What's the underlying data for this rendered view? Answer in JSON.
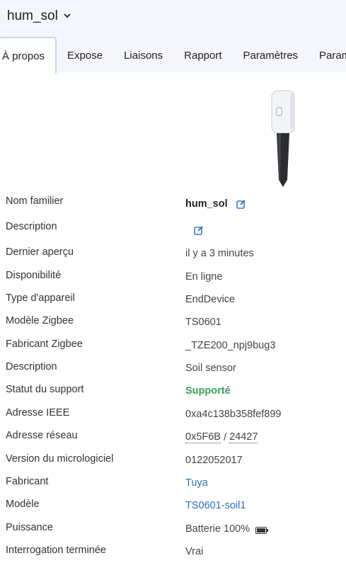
{
  "header": {
    "device_name": "hum_sol"
  },
  "tabs": [
    {
      "label": "À propos",
      "active": true
    },
    {
      "label": "Expose"
    },
    {
      "label": "Liaisons"
    },
    {
      "label": "Rapport"
    },
    {
      "label": "Paramètres"
    },
    {
      "label": "Param"
    }
  ],
  "details": {
    "friendly_name": {
      "label": "Nom familier",
      "value": "hum_sol"
    },
    "description_edit": {
      "label": "Description"
    },
    "last_seen": {
      "label": "Dernier aperçu",
      "value": "il y a 3 minutes"
    },
    "availability": {
      "label": "Disponibilité",
      "value": "En ligne"
    },
    "device_type": {
      "label": "Type d'appareil",
      "value": "EndDevice"
    },
    "zigbee_model": {
      "label": "Modèle Zigbee",
      "value": "TS0601"
    },
    "zigbee_manufacturer": {
      "label": "Fabricant Zigbee",
      "value": "_TZE200_npj9bug3"
    },
    "description": {
      "label": "Description",
      "value": "Soil sensor"
    },
    "support_status": {
      "label": "Statut du support",
      "value": "Supporté"
    },
    "ieee_address": {
      "label": "Adresse IEEE",
      "value": "0xa4c138b358fef899"
    },
    "network_address": {
      "label": "Adresse réseau",
      "hex": "0x5F6B",
      "separator": " / ",
      "dec": "24427"
    },
    "firmware": {
      "label": "Version du micrologiciel",
      "value": "0122052017"
    },
    "manufacturer": {
      "label": "Fabricant",
      "value": "Tuya"
    },
    "model": {
      "label": "Modèle",
      "value": "TS0601-soil1"
    },
    "power": {
      "label": "Puissance",
      "value": "Batterie 100%"
    },
    "interview": {
      "label": "Interrogation terminée",
      "value": "Vrai"
    }
  },
  "colors": {
    "supported": "#3c9f5a",
    "link": "#2a6ebb",
    "edit_icon": "#3a78d0"
  },
  "icons": {
    "edit": "edit-icon",
    "battery": "battery-icon",
    "dropdown": "chevron-down-icon"
  }
}
